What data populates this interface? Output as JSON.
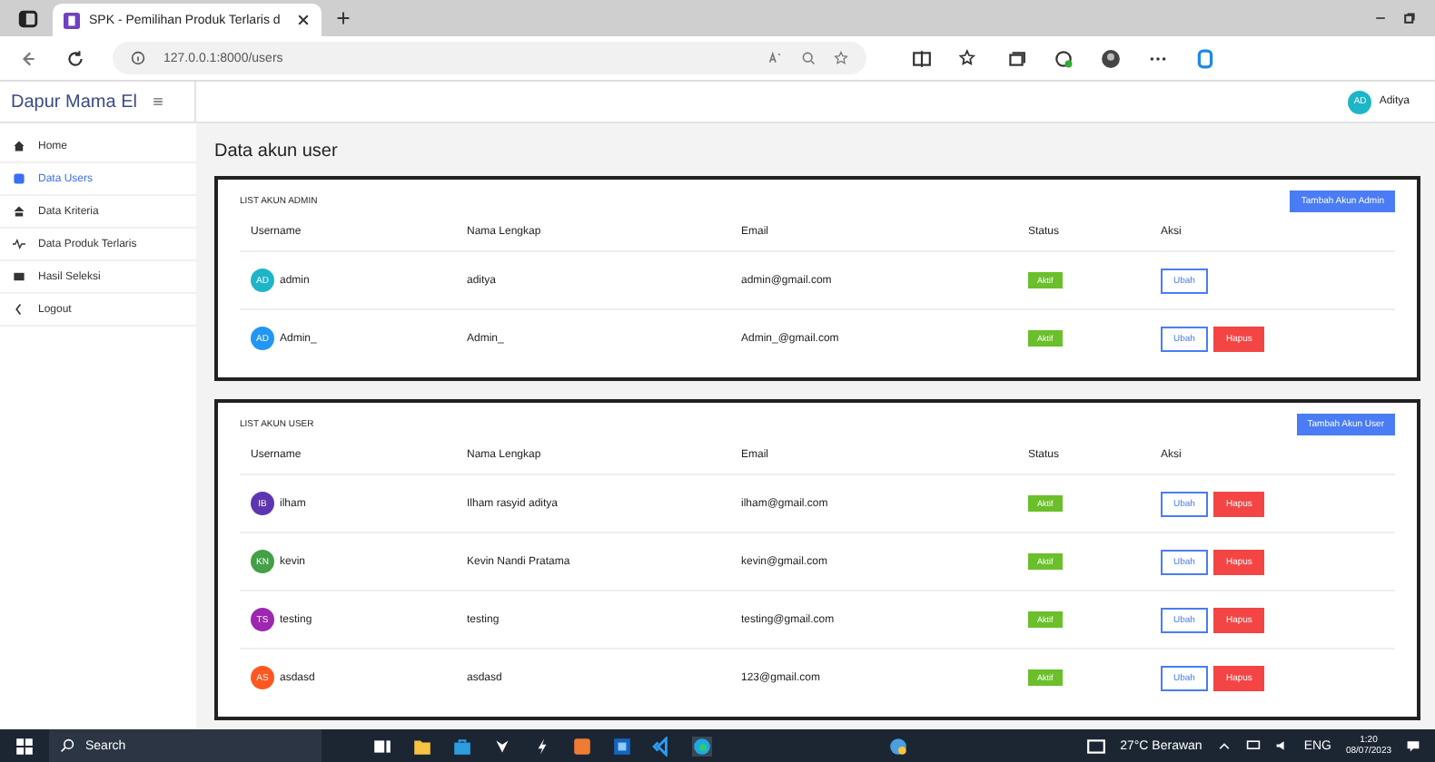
{
  "browser": {
    "tab_title": "SPK - Pemilihan Produk Terlaris d",
    "url": "127.0.0.1:8000/users"
  },
  "header": {
    "brand": "Dapur Mama El",
    "user": {
      "initials": "AD",
      "name": "Aditya"
    }
  },
  "sidebar": {
    "items": [
      {
        "label": "Home",
        "selected": false
      },
      {
        "label": "Data Users",
        "selected": true
      },
      {
        "label": "Data Kriteria",
        "selected": false
      },
      {
        "label": "Data Produk Terlaris",
        "selected": false
      },
      {
        "label": "Hasil Seleksi",
        "selected": false
      },
      {
        "label": "Logout",
        "selected": false
      }
    ]
  },
  "page_title": "Data akun user",
  "cards": [
    {
      "title": "LIST AKUN ADMIN",
      "add_button": "Tambah Akun Admin",
      "columns": [
        "Username",
        "Nama Lengkap",
        "Email",
        "Status",
        "Aksi"
      ],
      "rows": [
        {
          "initials": "AD",
          "color": "#1fb5c9",
          "username": "admin",
          "full_name": "aditya",
          "email": "admin@gmail.com",
          "status": "Aktif",
          "actions": [
            "Ubah"
          ]
        },
        {
          "initials": "AD",
          "color": "#2196f3",
          "username": "Admin_",
          "full_name": "Admin_",
          "email": "Admin_@gmail.com",
          "status": "Aktif",
          "actions": [
            "Ubah",
            "Hapus"
          ]
        }
      ]
    },
    {
      "title": "LIST AKUN USER",
      "add_button": "Tambah Akun User",
      "columns": [
        "Username",
        "Nama Lengkap",
        "Email",
        "Status",
        "Aksi"
      ],
      "rows": [
        {
          "initials": "IB",
          "color": "#5e35b1",
          "username": "ilham",
          "full_name": "Ilham rasyid aditya",
          "email": "ilham@gmail.com",
          "status": "Aktif",
          "actions": [
            "Ubah",
            "Hapus"
          ]
        },
        {
          "initials": "KN",
          "color": "#43a047",
          "username": "kevin",
          "full_name": "Kevin Nandi Pratama",
          "email": "kevin@gmail.com",
          "status": "Aktif",
          "actions": [
            "Ubah",
            "Hapus"
          ]
        },
        {
          "initials": "TS",
          "color": "#9c27b0",
          "username": "testing",
          "full_name": "testing",
          "email": "testing@gmail.com",
          "status": "Aktif",
          "actions": [
            "Ubah",
            "Hapus"
          ]
        },
        {
          "initials": "AS",
          "color": "#ff5722",
          "username": "asdasd",
          "full_name": "asdasd",
          "email": "123@gmail.com",
          "status": "Aktif",
          "actions": [
            "Ubah",
            "Hapus"
          ]
        }
      ]
    }
  ],
  "taskbar": {
    "search": "Search",
    "weather": "27°C Berawan",
    "language": "ENG",
    "time": "1:20",
    "date": "08/07/2023"
  }
}
